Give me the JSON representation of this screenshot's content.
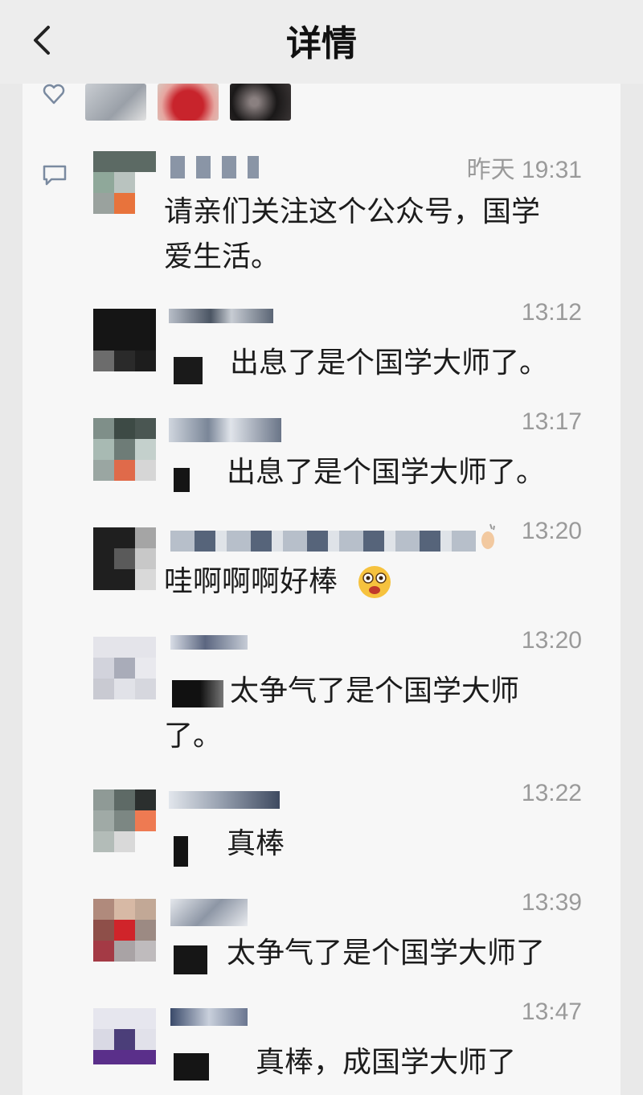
{
  "header": {
    "title": "详情"
  },
  "moment": {
    "comments": [
      {
        "time": "昨天 19:31",
        "text_line1": "请亲们关注这个公众号，国学",
        "text_line2": "爱生活。"
      },
      {
        "time": "13:12",
        "text": "出息了是个国学大师了。"
      },
      {
        "time": "13:17",
        "text": "出息了是个国学大师了。"
      },
      {
        "time": "13:20",
        "text": "哇啊啊啊好棒"
      },
      {
        "time": "13:20",
        "text_line1": "太争气了是个国学大师",
        "text_line2": "了。"
      },
      {
        "time": "13:22",
        "text": "真棒"
      },
      {
        "time": "13:39",
        "text": "太争气了是个国学大师了"
      },
      {
        "time": "13:47",
        "text": "真棒，成国学大师了"
      }
    ]
  },
  "icons": {
    "back": "chevron-left-icon",
    "like": "heart-outline-icon",
    "comment": "comment-bubble-icon",
    "emoji": "star-struck-face-icon",
    "clap": "clapping-hand-icon"
  },
  "colors": {
    "header_bg": "#ededed",
    "panel_bg": "#f7f7f7",
    "text": "#1c1c1c",
    "time": "#9a9a9a"
  }
}
